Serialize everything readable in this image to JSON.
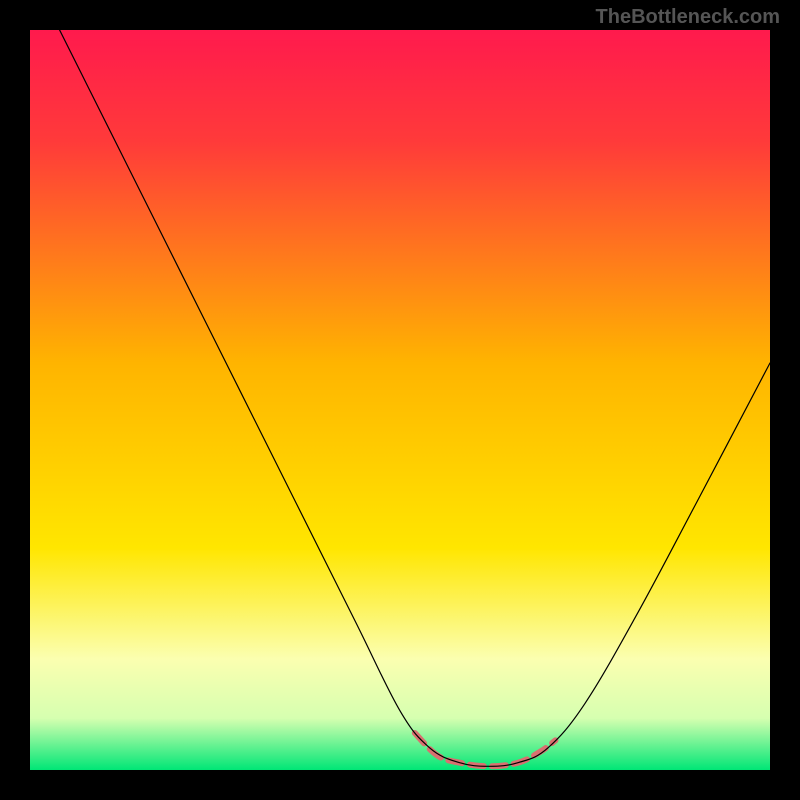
{
  "watermark": "TheBottleneck.com",
  "chart_data": {
    "type": "line",
    "title": "",
    "xlabel": "",
    "ylabel": "",
    "xlim": [
      0,
      100
    ],
    "ylim": [
      0,
      100
    ],
    "background_gradient": {
      "stops": [
        {
          "offset": 0.0,
          "color": "#ff1a4d"
        },
        {
          "offset": 0.15,
          "color": "#ff3a3a"
        },
        {
          "offset": 0.45,
          "color": "#ffb400"
        },
        {
          "offset": 0.7,
          "color": "#ffe600"
        },
        {
          "offset": 0.85,
          "color": "#fbffb0"
        },
        {
          "offset": 0.93,
          "color": "#d6ffb0"
        },
        {
          "offset": 1.0,
          "color": "#00e676"
        }
      ]
    },
    "series": [
      {
        "name": "curve",
        "color": "#000000",
        "width": 1.2,
        "points": [
          {
            "x": 4,
            "y": 100
          },
          {
            "x": 7,
            "y": 94
          },
          {
            "x": 12,
            "y": 84
          },
          {
            "x": 20,
            "y": 68
          },
          {
            "x": 28,
            "y": 52
          },
          {
            "x": 36,
            "y": 36
          },
          {
            "x": 44,
            "y": 20
          },
          {
            "x": 50,
            "y": 8
          },
          {
            "x": 54,
            "y": 3
          },
          {
            "x": 58,
            "y": 1
          },
          {
            "x": 62,
            "y": 0.5
          },
          {
            "x": 66,
            "y": 1
          },
          {
            "x": 70,
            "y": 3
          },
          {
            "x": 75,
            "y": 9
          },
          {
            "x": 82,
            "y": 21
          },
          {
            "x": 90,
            "y": 36
          },
          {
            "x": 100,
            "y": 55
          }
        ]
      },
      {
        "name": "highlight-band",
        "color": "#d97070",
        "width": 6,
        "points": [
          {
            "x": 52,
            "y": 5
          },
          {
            "x": 55,
            "y": 2
          },
          {
            "x": 58,
            "y": 1
          },
          {
            "x": 62,
            "y": 0.5
          },
          {
            "x": 66,
            "y": 1
          },
          {
            "x": 69,
            "y": 2.5
          },
          {
            "x": 71,
            "y": 4
          }
        ]
      }
    ]
  }
}
